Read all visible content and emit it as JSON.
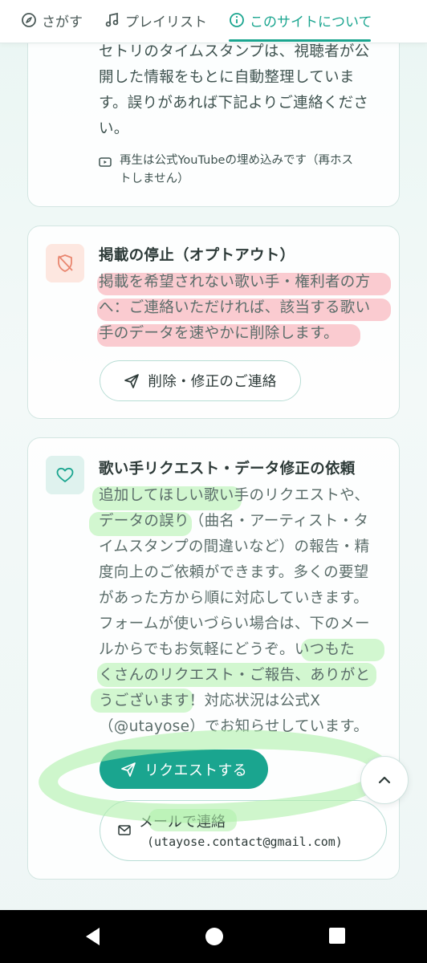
{
  "nav": {
    "tabs": [
      {
        "label": "さがす",
        "icon": "compass-icon"
      },
      {
        "label": "プレイリスト",
        "icon": "music-note-icon"
      },
      {
        "label": "このサイトについて",
        "icon": "info-icon",
        "active": true
      }
    ]
  },
  "card1": {
    "lines": [
      "セトリのタイムスタンプは、視聴者が公",
      "開した情報をもとに自動整理していま",
      "す。誤りがあれば下記よりご連絡くださ",
      "い。"
    ],
    "note_lines": [
      "再生は公式YouTubeの埋め込みです（再ホス",
      "トしません）"
    ]
  },
  "card2": {
    "title": "掲載の停止（オプトアウト）",
    "lines": [
      "掲載を希望されない歌い手・権利者の方",
      "へ：ご連絡いただければ、該当する歌い",
      "手のデータを速やかに削除します。"
    ],
    "button": "削除・修正のご連絡"
  },
  "card3": {
    "title": "歌い手リクエスト・データ修正の依頼",
    "lines": [
      "追加してほしい歌い手のリクエストや、",
      "データの誤り（曲名・アーティスト・タ",
      "イムスタンプの間違いなど）の報告・精",
      "度向上のご依頼ができます。多くの要望",
      "があった方から順に対応していきます。",
      "フォームが使いづらい場合は、下のメー",
      "ルからでもお気軽にどうぞ。いつもた",
      "くさんのリクエスト・ご報告、ありがと",
      "うございます！対応状況は公式X",
      "（@utayose）でお知らせしています。"
    ],
    "request_button": "リクエストする",
    "mail_label": "メールで連絡",
    "mail_address": "(utayose.contact@gmail.com)"
  },
  "colors": {
    "accent": "#1aa58f",
    "highlight_red": "#f7a0aa",
    "highlight_green": "#aff0aa"
  }
}
